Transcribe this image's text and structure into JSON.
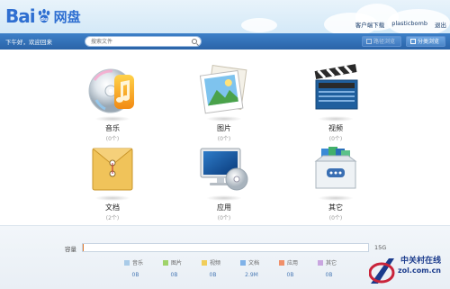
{
  "header": {
    "logo_text": "Bai",
    "logo_suffix": "网盘",
    "links": [
      "客户端下载",
      "plasticbomb",
      "退出"
    ]
  },
  "navbar": {
    "greeting": "下午好，欢迎回来",
    "search_placeholder": "搜索文件",
    "path_view_label": "路径浏览",
    "category_view_label": "分类浏览"
  },
  "categories": [
    {
      "label": "音乐",
      "count": "(0个)"
    },
    {
      "label": "图片",
      "count": "(0个)"
    },
    {
      "label": "视频",
      "count": "(0个)"
    },
    {
      "label": "文档",
      "count": "(2个)"
    },
    {
      "label": "应用",
      "count": "(0个)"
    },
    {
      "label": "其它",
      "count": "(0个)"
    }
  ],
  "storage": {
    "label": "容量",
    "total": "15G",
    "used_fraction": 0.0002,
    "legend": [
      {
        "name": "音乐",
        "value": "0B",
        "color": "#a9cbe8"
      },
      {
        "name": "图片",
        "value": "0B",
        "color": "#9fd36a"
      },
      {
        "name": "视频",
        "value": "0B",
        "color": "#f0cd5a"
      },
      {
        "name": "文档",
        "value": "2.9M",
        "color": "#7fb2e8"
      },
      {
        "name": "应用",
        "value": "0B",
        "color": "#f0906a"
      },
      {
        "name": "其它",
        "value": "0B",
        "color": "#c9a6e0"
      }
    ]
  },
  "watermark": {
    "cn": "中关村在线",
    "url": "zol.com.cn"
  }
}
